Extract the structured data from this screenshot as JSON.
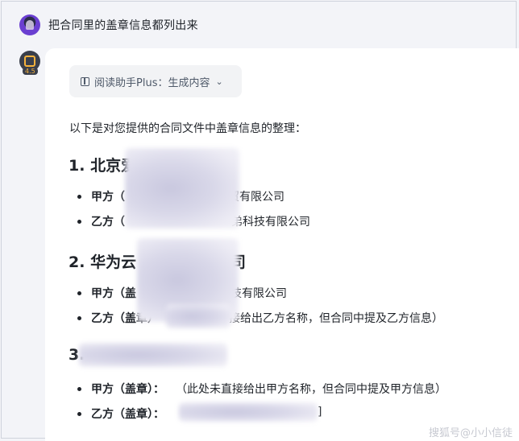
{
  "user_message": {
    "text": "把合同里的盖章信息都列出来"
  },
  "bot": {
    "badge": "4.5",
    "reader_chip": {
      "label": "阅读助手Plus：生成内容",
      "icon": "book-icon",
      "chevron": "⌄"
    },
    "intro": "以下是对您提供的合同文件中盖章信息的整理：",
    "sections": [
      {
        "number": "1.",
        "title_visible": "北京爱",
        "items": [
          {
            "label": "甲方（",
            "value_fragment": "贸有限公司"
          },
          {
            "label": "乙方（",
            "value_fragment": "弟科技有限公司"
          }
        ]
      },
      {
        "number": "2.",
        "title_visible": "华为云",
        "title_tail": "司",
        "items": [
          {
            "label": "甲方（盖",
            "value_fragment": "技有限公司"
          },
          {
            "label": "乙方（盖章）",
            "value_fragment": "接给出乙方名称，但合同中提及乙方信息）"
          }
        ]
      },
      {
        "number": "3.",
        "items": [
          {
            "label": "甲方（盖章）：",
            "value_fragment": "（此处未直接给出甲方名称，但合同中提及甲方信息）"
          },
          {
            "label": "乙方（盖章）：",
            "value_fragment": "]"
          }
        ]
      }
    ]
  },
  "watermark": "搜狐号@小小信徒"
}
